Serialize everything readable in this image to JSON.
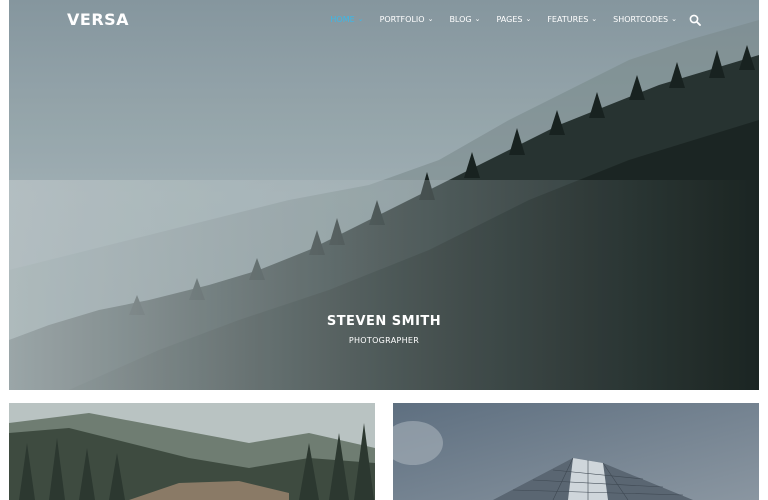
{
  "brand": {
    "logo": "VERSA"
  },
  "nav": {
    "items": [
      {
        "label": "HOME",
        "active": true
      },
      {
        "label": "PORTFOLIO",
        "active": false
      },
      {
        "label": "BLOG",
        "active": false
      },
      {
        "label": "PAGES",
        "active": false
      },
      {
        "label": "FEATURES",
        "active": false
      },
      {
        "label": "SHORTCODES",
        "active": false
      }
    ],
    "chevron": "⌄",
    "search_icon": "search-icon"
  },
  "hero": {
    "title": "STEVEN SMITH",
    "subtitle": "PHOTOGRAPHER"
  },
  "colors": {
    "accent": "#3bb8e8",
    "text_light": "#ffffff",
    "forest_dark": "#1f2b28",
    "mist": "#a9b8bc"
  },
  "tiles": [
    {
      "subject": "forest-hillside-photo"
    },
    {
      "subject": "skyscraper-photo"
    }
  ]
}
